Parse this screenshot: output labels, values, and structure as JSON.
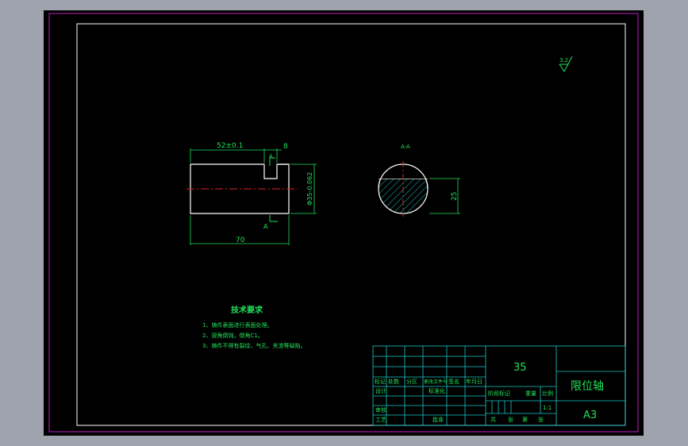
{
  "drawing": {
    "colors": {
      "background_outer": "#9fa3ad",
      "sheet": "#000000",
      "trim_border": "#c020c0",
      "frame": "#ffffff",
      "dimension": "#21e05a",
      "centerline": "#e02020",
      "title_block": "#19c9c9",
      "hatch": "#19c9c9"
    },
    "surface_finish": "3.2",
    "front_view": {
      "dim_length_slot": "52±0.1",
      "dim_slot_width": "8",
      "dim_diameter": "Φ35-0.062",
      "dim_total_length": "70",
      "section_marker_top": "A",
      "section_marker_bottom": "A"
    },
    "section_view": {
      "label": "A-A",
      "dim_flat": "25"
    },
    "technical_requirements": {
      "title": "技术要求",
      "items": [
        "1、铸件表面进行表面处理。",
        "2、锐角倒钝，倒角C1。",
        "3、铸件不得有裂纹、气孔、夹渣等缺陷。"
      ]
    },
    "title_block": {
      "material": "35",
      "part_name": "限位轴",
      "paper_size": "A3",
      "scale": "1:1",
      "headers": [
        "标记",
        "处数",
        "分区",
        "更改文件号",
        "签名",
        "年月日"
      ],
      "row_labels_left": [
        "设计",
        "审核",
        "工艺"
      ],
      "row_labels_mid": [
        "标准化",
        "",
        "批准"
      ],
      "stage_labels": [
        "阶段标记",
        "重量",
        "比例"
      ],
      "sheet_labels": [
        "共",
        "张",
        "第",
        "张"
      ]
    }
  }
}
